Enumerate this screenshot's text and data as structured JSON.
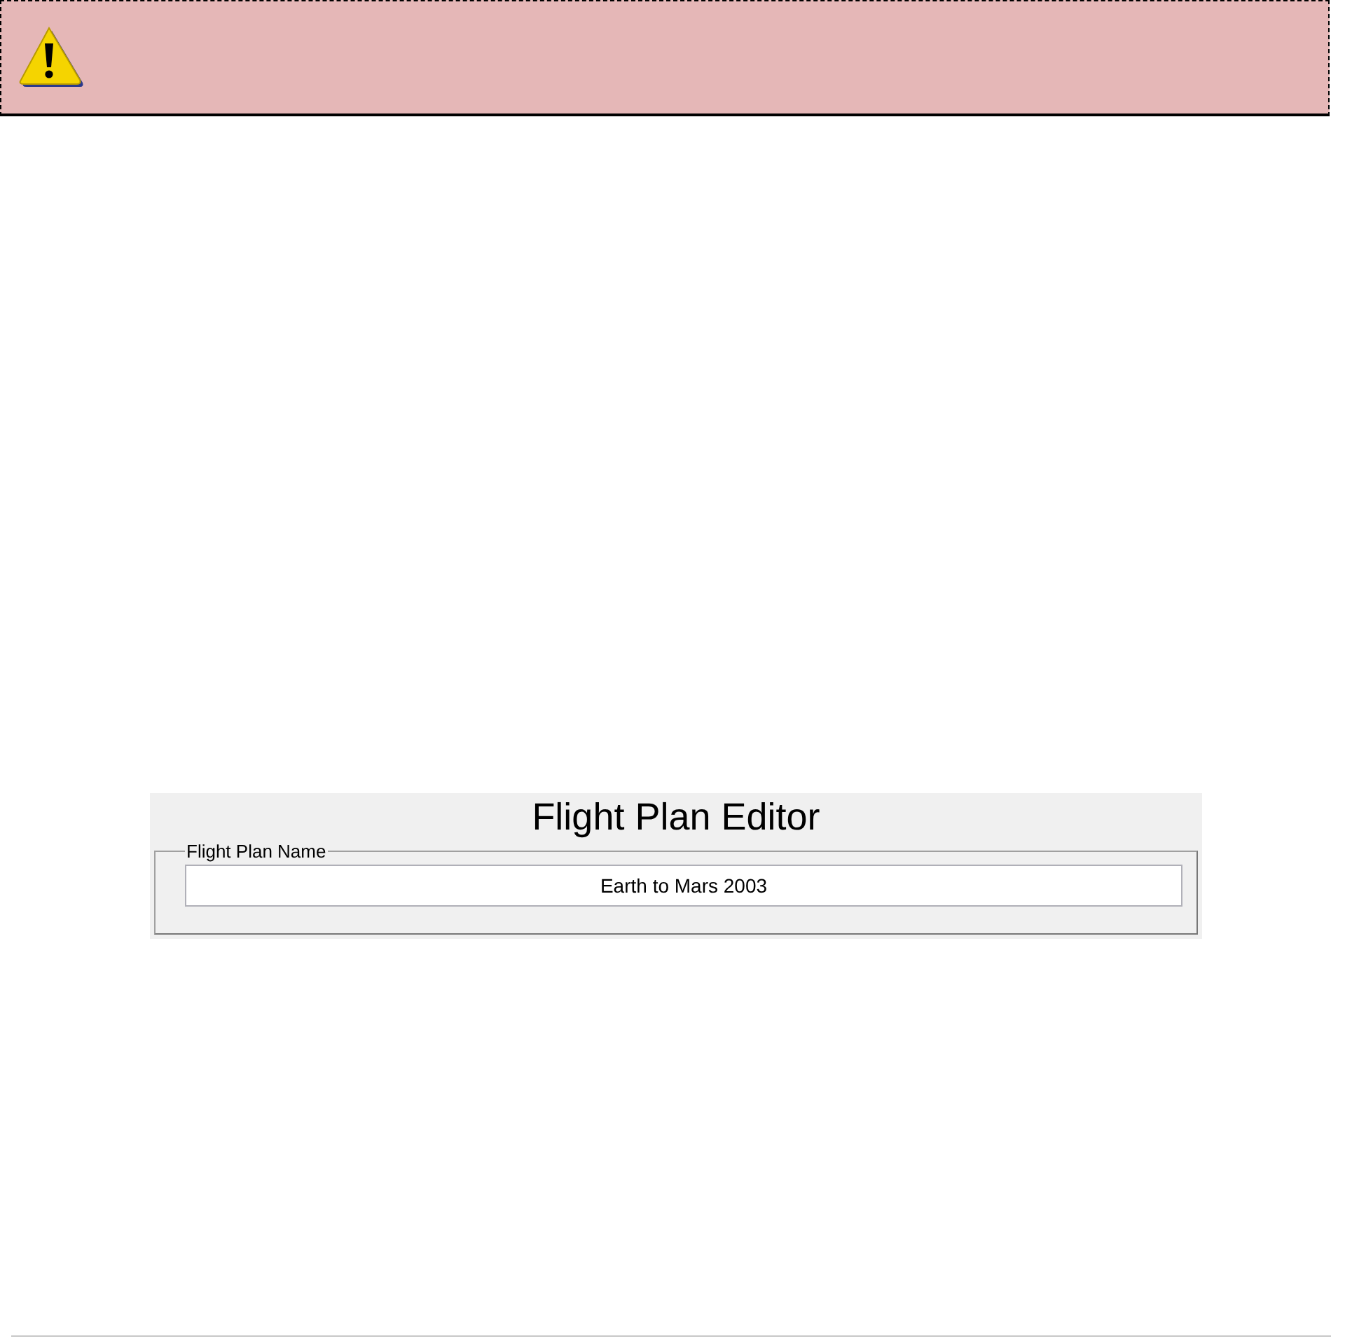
{
  "banner": {
    "kind": "warning"
  },
  "editor": {
    "title": "Flight Plan Editor",
    "group_label": "Flight Plan Name",
    "name_value": "Earth to Mars 2003"
  }
}
